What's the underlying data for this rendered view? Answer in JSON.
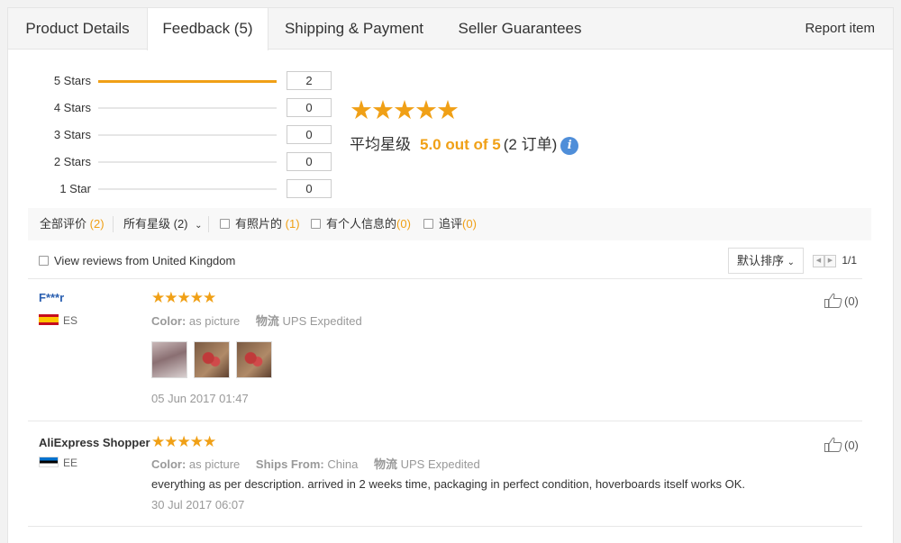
{
  "tabs": [
    {
      "label": "Product Details"
    },
    {
      "label": "Feedback (5)"
    },
    {
      "label": "Shipping & Payment"
    },
    {
      "label": "Seller Guarantees"
    }
  ],
  "report_item": "Report item",
  "rating_distribution": [
    {
      "label": "5 Stars",
      "count": "2",
      "fill_fraction": 1.0
    },
    {
      "label": "4 Stars",
      "count": "0",
      "fill_fraction": 0
    },
    {
      "label": "3 Stars",
      "count": "0",
      "fill_fraction": 0
    },
    {
      "label": "2 Stars",
      "count": "0",
      "fill_fraction": 0
    },
    {
      "label": "1 Star",
      "count": "0",
      "fill_fraction": 0
    }
  ],
  "summary": {
    "stars": "★★★★★",
    "avg_label": "平均星级",
    "score": "5.0 out of 5",
    "orders": "(2 订单)",
    "info": "i"
  },
  "filters": {
    "all_label": "全部评价",
    "all_count": "(2)",
    "stars_label": "所有星级 (2)",
    "photo_label": "有照片的",
    "photo_count": "(1)",
    "personal_label": "有个人信息的",
    "personal_count": "(0)",
    "followup_label": "追评",
    "followup_count": "(0)"
  },
  "uk_filter": "View reviews from United Kingdom",
  "sort_label": "默认排序",
  "pager": {
    "page": "1/1"
  },
  "reviews": [
    {
      "name": "F***r",
      "country": "ES",
      "stars": "★★★★★",
      "color_key": "Color:",
      "color_val": "as picture",
      "logistics_key": "物流",
      "logistics_val": "UPS Expedited",
      "date": "05 Jun 2017 01:47",
      "likes": "(0)"
    },
    {
      "name": "AliExpress Shopper",
      "country": "EE",
      "stars": "★★★★★",
      "color_key": "Color:",
      "color_val": "as picture",
      "ships_key": "Ships From:",
      "ships_val": "China",
      "logistics_key": "物流",
      "logistics_val": "UPS Expedited",
      "text": "everything as per description. arrived in 2 weeks time, packaging in perfect condition, hoverboards itself works OK.",
      "date": "30 Jul 2017 06:07",
      "likes": "(0)"
    }
  ],
  "colors": {
    "accent": "#f0a016",
    "link": "#2a5fb0",
    "info": "#4f8ed9"
  }
}
